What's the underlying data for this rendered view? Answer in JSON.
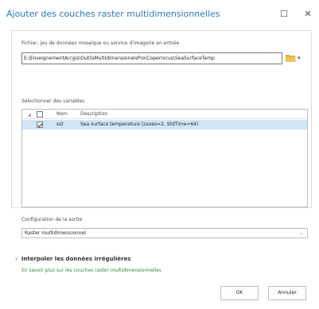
{
  "window": {
    "title": "Ajouter des couches raster multidimensionnelles",
    "restore_glyph": "☐",
    "close_glyph": "✕"
  },
  "input": {
    "label": "Fichier, jeu de données mosaïque ou service d'imagerie en entrée",
    "value": "E:\\EnseignementArcgis\\OutilsMultidimensionelsPro\\Copernicus\\SeaSurfaceTemp",
    "dropdown_glyph": "▾"
  },
  "variables": {
    "label": "Sélectionner des variables",
    "columns": {
      "name": "Nom",
      "description": "Description"
    },
    "rows": [
      {
        "name": "sst",
        "description": "Sea surface temperature (zaxes=2, StdTime=64)",
        "checked": true
      }
    ]
  },
  "output": {
    "label": "Configuration de la sortie",
    "selected": "Raster multidimensionnel",
    "chevron": "⌄"
  },
  "interpolate": {
    "arrow": "›",
    "label": "Interpoler les données irrégulières"
  },
  "link": {
    "text": "En savoir plus sur les couches raster multidimensionnelles"
  },
  "buttons": {
    "ok": "OK",
    "cancel": "Annuler"
  },
  "colors": {
    "title": "#2b7ab8",
    "selection": "#cfe6f8",
    "link": "#2e8b3a",
    "folder": "#e3a92c"
  }
}
